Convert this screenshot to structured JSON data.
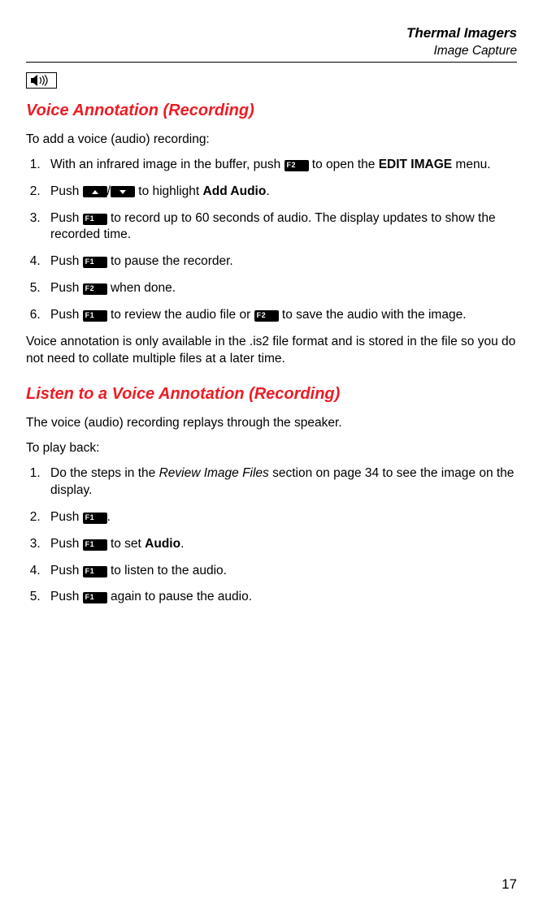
{
  "header": {
    "title": "Thermal Imagers",
    "subtitle": "Image Capture"
  },
  "keys": {
    "f1": "F1",
    "f2": "F2"
  },
  "section1": {
    "heading": "Voice Annotation (Recording)",
    "intro": "To add a voice (audio) recording:",
    "step1_a": "With an infrared image in the buffer, push ",
    "step1_b": " to open the ",
    "step1_bold": "EDIT IMAGE",
    "step1_c": " menu.",
    "step2_a": "Push ",
    "step2_b": "/",
    "step2_c": " to highlight ",
    "step2_bold": "Add Audio",
    "step2_d": ".",
    "step3_a": "Push ",
    "step3_b": " to record up to 60 seconds of audio. The display updates to show the recorded time.",
    "step4_a": "Push ",
    "step4_b": " to pause the recorder.",
    "step5_a": "Push ",
    "step5_b": " when done.",
    "step6_a": "Push ",
    "step6_b": " to review the audio file or ",
    "step6_c": " to save the audio with the image.",
    "note": "Voice annotation is only available in the .is2 file format and is stored in the file so you do not need to collate multiple files at a later time."
  },
  "section2": {
    "heading": "Listen to a Voice Annotation (Recording)",
    "intro1": "The voice (audio) recording replays through the speaker.",
    "intro2": "To play back:",
    "step1_a": "Do the steps in the ",
    "step1_italic": "Review Image Files",
    "step1_b": " section on page 34 to see the image on the display.",
    "step2_a": "Push ",
    "step2_b": ".",
    "step3_a": "Push ",
    "step3_b": " to set ",
    "step3_bold": "Audio",
    "step3_c": ".",
    "step4_a": "Push ",
    "step4_b": " to listen to the audio.",
    "step5_a": "Push ",
    "step5_b": " again to pause the audio."
  },
  "pageNumber": "17"
}
